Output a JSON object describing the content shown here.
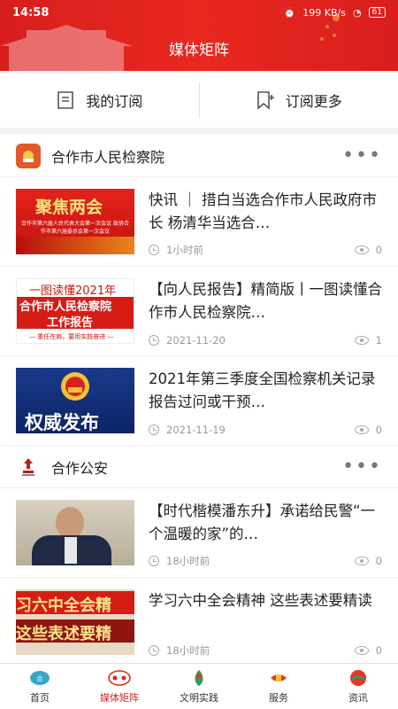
{
  "status": {
    "time": "14:58",
    "network_speed": "199 KB/s",
    "battery": "61"
  },
  "header": {
    "title": "媒体矩阵"
  },
  "subscribe": {
    "mine": "我的订阅",
    "more": "订阅更多"
  },
  "sections": [
    {
      "name": "合作市人民检察院",
      "articles": [
        {
          "title": "快讯 ｜ 措白当选合作市人民政府市长 杨清华当选合…",
          "time": "1小时前",
          "views": "0",
          "thumb_text": "聚焦两会",
          "thumb_sub": "合作市第六届人民代表大会第一次会议 政协合作市第六届委员会第一次会议"
        },
        {
          "title": "【向人民报告】精简版丨一图读懂合作市人民检察院…",
          "time": "2021-11-20",
          "views": "1",
          "thumb_line1": "一图读懂2021年",
          "thumb_line2": "合作市人民检察院",
          "thumb_line3": "工作报告",
          "thumb_sub": "— 重任在肩，要用实践奋进 —"
        },
        {
          "title": "2021年第三季度全国检察机关记录报告过问或干预…",
          "time": "2021-11-19",
          "views": "0",
          "thumb_text": "权威发布"
        }
      ]
    },
    {
      "name": "合作公安",
      "articles": [
        {
          "title": "【时代楷模潘东升】承诺给民警“一个温暖的家”的…",
          "time": "18小时前",
          "views": "0"
        },
        {
          "title": "学习六中全会精神 这些表述要精读",
          "time": "18小时前",
          "views": "0",
          "thumb_line1": "习六中全会精",
          "thumb_line2": "这些表述要精"
        }
      ]
    }
  ],
  "tabs": [
    {
      "label": "首页",
      "icon": "home-icon"
    },
    {
      "label": "媒体矩阵",
      "icon": "media-matrix-icon",
      "active": true
    },
    {
      "label": "文明实践",
      "icon": "civilization-icon"
    },
    {
      "label": "服务",
      "icon": "service-icon"
    },
    {
      "label": "资讯",
      "icon": "news-icon"
    }
  ],
  "colors": {
    "brand_red": "#d9261c",
    "header_red": "#e8281f"
  }
}
